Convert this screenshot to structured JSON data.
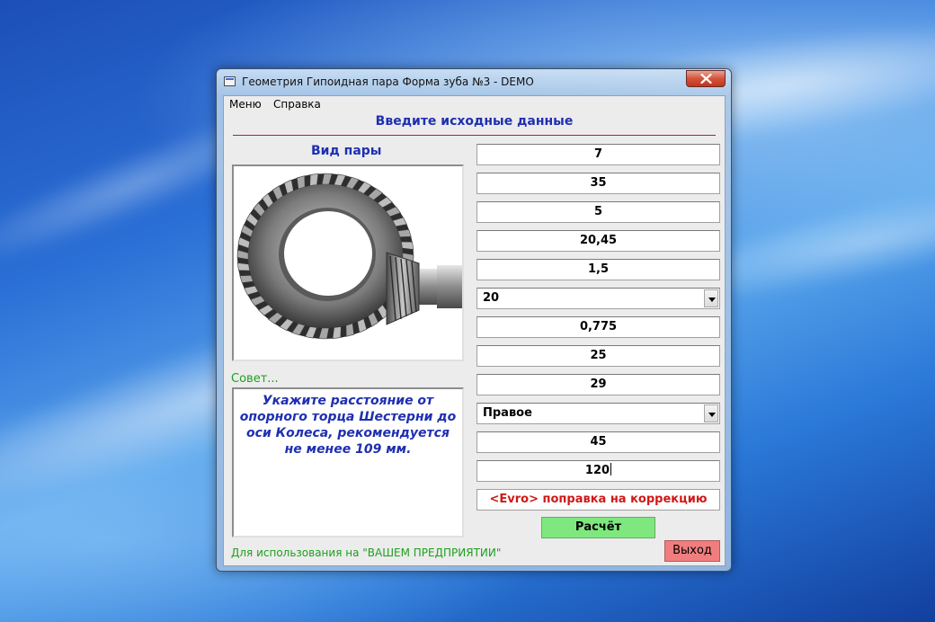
{
  "window": {
    "title": "Геометрия Гипоидная пара Форма зуба №3 - DEMO"
  },
  "menu": {
    "items": [
      "Меню",
      "Справка"
    ]
  },
  "header": {
    "title": "Введите исходные данные"
  },
  "pair_view": {
    "label": "Вид пары",
    "image_icon": "hypoid-gear-pair-icon"
  },
  "hint": {
    "label": "Совет...",
    "text": "Укажите расстояние от опорного торца Шестерни до оси Колеса, рекомендуется не менее 109 мм."
  },
  "inputs": {
    "f1": "7",
    "f2": "35",
    "f3": "5",
    "f4": "20,45",
    "f5": "1,5",
    "combo1": "20",
    "f7": "0,775",
    "f8": "25",
    "f9": "29",
    "combo2": "Правое",
    "f11": "45",
    "f12": "120"
  },
  "evro": {
    "label": "<Evro> поправка на коррекцию"
  },
  "buttons": {
    "calc": "Расчёт",
    "exit": "Выход"
  },
  "footer": {
    "text": "Для использования на  \"ВАШЕМ ПРЕДПРИЯТИИ\""
  },
  "colors": {
    "header_blue": "#1f2fb0",
    "hint_green": "#1ea01e",
    "evro_red": "#d01818",
    "calc_green": "#7ee87e",
    "exit_red": "#f07e7e"
  }
}
